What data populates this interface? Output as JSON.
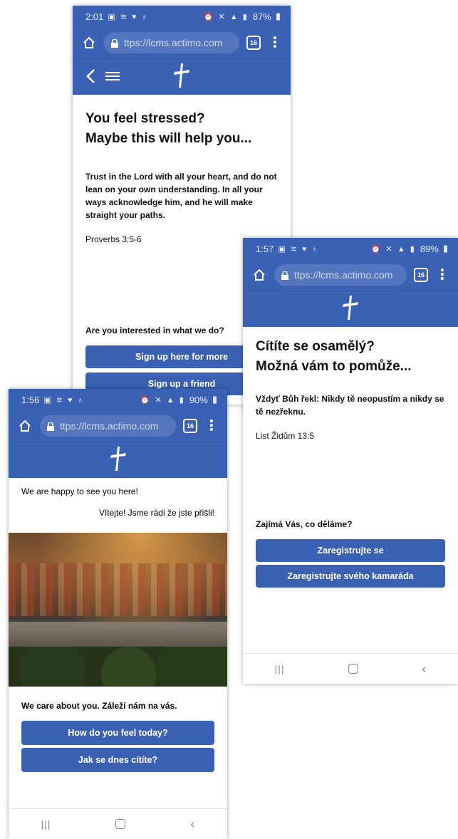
{
  "colors": {
    "brand_blue": "#3a61b3",
    "url_pill": "#5476bf",
    "button_text": "#ffffff"
  },
  "phones": {
    "top": {
      "status": {
        "time": "2:01",
        "battery": "87%"
      },
      "url": "ttps://lcms.actimo.com",
      "tab_count": "16",
      "title_line1": "You feel stressed?",
      "title_line2": "Maybe this will help you...",
      "verse": "Trust in the Lord with all your heart, and do not lean on your own understanding.  In all your ways acknowledge him, and he will make straight your paths.",
      "reference": "Proverbs 3:5-6",
      "question": "Are you interested in what we do?",
      "button1": "Sign up here for more",
      "button2": "Sign up a friend"
    },
    "right": {
      "status": {
        "time": "1:57",
        "battery": "89%"
      },
      "url": "ttps://lcms.actimo.com",
      "tab_count": "16",
      "title_line1": "Cítíte se osamělý?",
      "title_line2": "Možná vám to pomůže...",
      "verse": "Vždyť Bůh řekl: Nikdy tě neopustím a nikdy se tě nezřeknu.",
      "reference": "List Židům 13:5",
      "question": "Zajímá Vás, co děláme?",
      "button1": "Zaregistrujte se",
      "button2": "Zaregistrujte svého kamaráda"
    },
    "left": {
      "status": {
        "time": "1:56",
        "battery": "90%"
      },
      "url": "ttps://lcms.actimo.com",
      "tab_count": "16",
      "welcome_en": "We are happy to see you here!",
      "welcome_cz": "Vítejte! Jsme rádi že jste přišli!",
      "care_text": "We care about you. Záleží nám na vás.",
      "button1": "How do you feel today?",
      "button2": "Jak se dnes cítíte?"
    }
  },
  "icons": {
    "status": "status-icons",
    "home": "home-icon",
    "lock": "lock-icon",
    "tabs": "tabs-icon",
    "menu": "menu-dots-icon",
    "back": "back-arrow-icon",
    "hamburger": "hamburger-icon",
    "logo": "cross-logo-icon",
    "nav_recent": "recent-apps-icon",
    "nav_home": "nav-home-icon",
    "nav_back": "nav-back-icon"
  }
}
